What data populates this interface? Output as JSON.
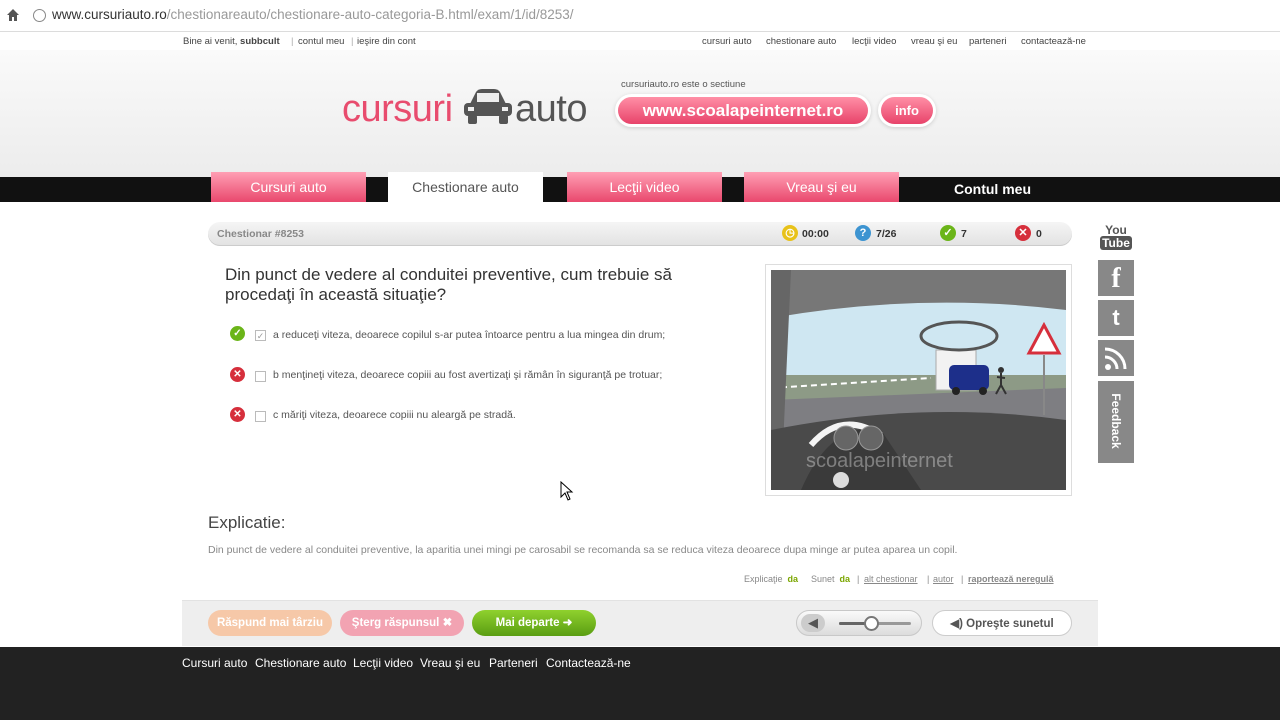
{
  "browser": {
    "url_host": "www.cursuriauto.ro",
    "url_path": "/chestionareauto/chestionare-auto-categoria-B.html/exam/1/id/8253/"
  },
  "toplinks": {
    "welcome_prefix": "Bine ai venit, ",
    "username": "subbcult",
    "account": "contul meu",
    "logout": "ieşire din cont",
    "right": [
      "cursuri auto",
      "chestionare auto",
      "lecţii video",
      "vreau şi eu",
      "parteneri",
      "contactează-ne"
    ]
  },
  "header": {
    "logo_left": "cursuri",
    "logo_right": "auto",
    "section_text": "cursuriauto.ro este o sectiune",
    "site_button": "www.scoalapeinternet.ro",
    "info_button": "info"
  },
  "nav": {
    "tabs": [
      "Cursuri auto",
      "Chestionare auto",
      "Lecţii video",
      "Vreau şi eu",
      "Contul meu"
    ],
    "active_index": 1
  },
  "quiz": {
    "title": "Chestionar #8253",
    "timer": "00:00",
    "progress": "7/26",
    "correct": "7",
    "wrong": "0",
    "question": "Din punct de vedere al conduitei preventive, cum trebuie să procedaţi în această situaţie?",
    "answers": [
      {
        "text": "a reduceţi viteza, deoarece copilul s-ar putea întoarce pentru a lua mingea din drum;",
        "status": "correct",
        "checked": true
      },
      {
        "text": "b menţineţi viteza, deoarece copiii au fost avertizaţi şi rămân în siguranţă pe trotuar;",
        "status": "wrong",
        "checked": false
      },
      {
        "text": "c măriţi viteza, deoarece copiii nu aleargă pe stradă.",
        "status": "wrong",
        "checked": false
      }
    ],
    "watermark": "scoalapeinternet",
    "explanation_heading": "Explicatie:",
    "explanation_text": "Din punct de vedere al conduitei preventive, la aparitia unei mingi pe carosabil se recomanda sa se reduca viteza deoarece dupa minge ar putea aparea un copil.",
    "meta": {
      "expl_label": "Explicaţie",
      "expl_val": "da",
      "sound_label": "Sunet",
      "sound_val": "da",
      "other": "alt chestionar",
      "author": "autor",
      "report": "raportează neregulă"
    }
  },
  "buttons": {
    "later": "Răspund mai târziu",
    "clear": "Şterg răspunsul",
    "next": "Mai departe",
    "mute": "Opreşte sunetul",
    "volume_level": 0.45
  },
  "social": {
    "youtube_top": "You",
    "youtube_bottom": "Tube",
    "facebook": "f",
    "feedback": "Feedback"
  },
  "footer": [
    "Cursuri auto",
    "Chestionare auto",
    "Lecţii video",
    "Vreau şi eu",
    "Parteneri",
    "Contactează-ne"
  ],
  "colors": {
    "brand_pink": "#e84c6e",
    "green": "#6bb519",
    "red": "#d62f3c"
  }
}
